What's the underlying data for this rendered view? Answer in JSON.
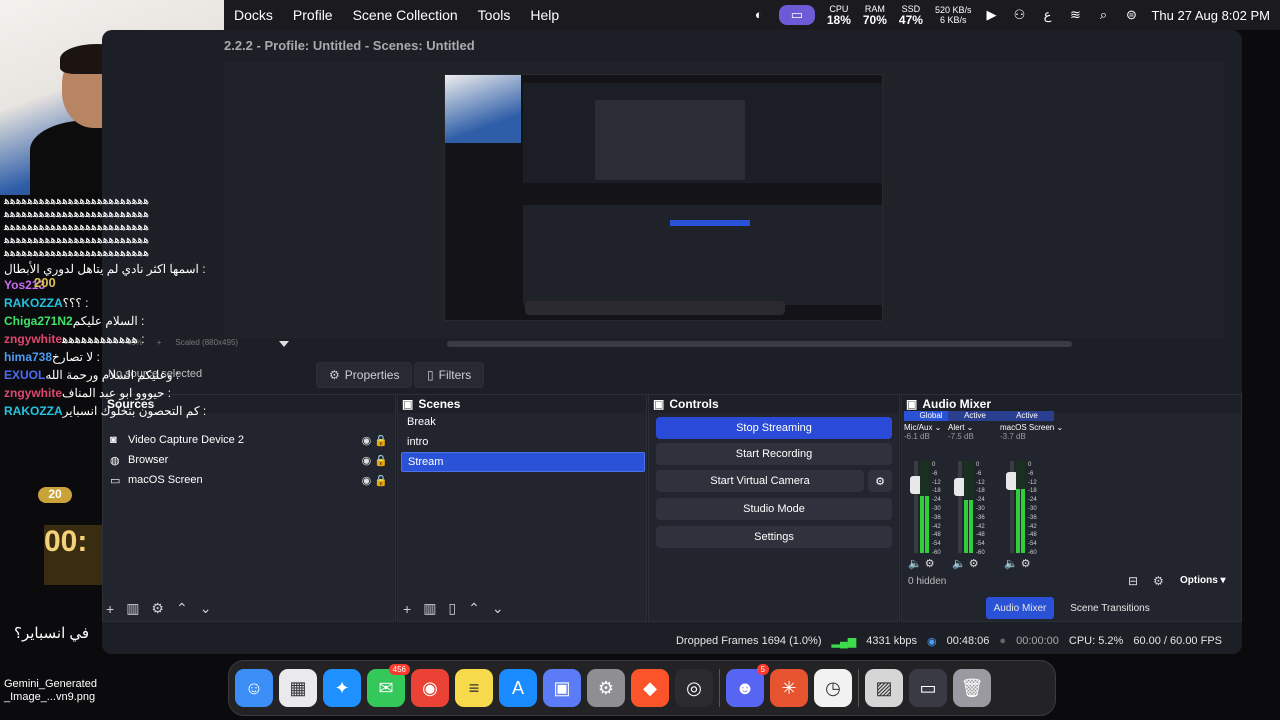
{
  "menubar": {
    "items": [
      "Docks",
      "Profile",
      "Scene Collection",
      "Tools",
      "Help"
    ],
    "cpu": {
      "label": "CPU",
      "value": "18%"
    },
    "ram": {
      "label": "RAM",
      "value": "70%"
    },
    "ssd": {
      "label": "SSD",
      "value": "47%"
    },
    "net_up": "520 KB/s",
    "net_down": "6 KB/s",
    "datetime": "Thu 27 Aug  8:02 PM"
  },
  "window_title": "2.2.2 - Profile: Untitled - Scenes: Untitled",
  "zoom": {
    "percent": "45%",
    "scaled": "Scaled (880x495)"
  },
  "properties_label": "Properties",
  "filters_label": "Filters",
  "no_source": "No source selected",
  "sources": {
    "header": "Sources",
    "items": [
      {
        "label": "Video Capture Device 2",
        "icon": "camera-icon"
      },
      {
        "label": "Browser",
        "icon": "globe-icon"
      },
      {
        "label": "macOS Screen",
        "icon": "monitor-icon"
      }
    ]
  },
  "scenes": {
    "header": "Scenes",
    "items": [
      "Break",
      "intro",
      "Stream"
    ],
    "selected": "Stream"
  },
  "controls": {
    "header": "Controls",
    "stop_streaming": "Stop Streaming",
    "start_recording": "Start Recording",
    "start_virtual_camera": "Start Virtual Camera",
    "studio_mode": "Studio Mode",
    "settings": "Settings"
  },
  "audio_mixer": {
    "header": "Audio Mixer",
    "channels": [
      {
        "tag": "Global",
        "name": "Mic/Aux",
        "db": "-6.1 dB",
        "level": 0.62,
        "slider": 0.9
      },
      {
        "tag": "Active",
        "name": "Alert",
        "db": "-7.5 dB",
        "level": 0.58,
        "slider": 0.88
      },
      {
        "tag": "Active",
        "name": "macOS Screen",
        "db": "-3.7 dB",
        "level": 0.7,
        "slider": 0.95
      }
    ],
    "scale": [
      "0",
      "-6",
      "-12",
      "-18",
      "-24",
      "-30",
      "-36",
      "-42",
      "-48",
      "-54",
      "-60"
    ],
    "hidden": "0 hidden",
    "options": "Options",
    "tab_mixer": "Audio Mixer",
    "tab_transitions": "Scene Transitions"
  },
  "status": {
    "dropped": "Dropped Frames 1694 (1.0%)",
    "kbps": "4331 kbps",
    "stream_time": "00:48:06",
    "rec_time": "00:00:00",
    "cpu": "CPU: 5.2%",
    "fps": "60.00 / 60.00 FPS"
  },
  "chat": {
    "spam": "ﻫﻫﻫﻫﻫﻫﻫﻫﻫﻫﻫﻫﻫﻫﻫﻫﻫﻫﻫﻫﻫﻫﻫﻫﻫ",
    "lines": [
      {
        "user": "Yos213",
        "color": "#c86cf2",
        "text": "اسمها اكثر نادي لم يتاهل لدوري الأبطال"
      },
      {
        "user": "RAKOZZA",
        "color": "#23c4e0",
        "text": "؟؟؟"
      },
      {
        "user": "Chiga271N2",
        "color": "#3ee36a",
        "text": "السلام عليكم"
      },
      {
        "user": "zngywhite",
        "color": "#e0466e",
        "text": "ﻫﻫﻫﻫﻫﻫﻫﻫﻫﻫﻫﻫ"
      },
      {
        "user": "hima738",
        "color": "#4a9cf5",
        "text": "لا تصارخ"
      },
      {
        "user": "EXUOL",
        "color": "#4a6cf5",
        "text": "وعليكم السلام ورحمة الله"
      },
      {
        "user": "zngywhite",
        "color": "#e0466e",
        "text": "حيووو ابو عبد المناف"
      },
      {
        "user": "RAKOZZA",
        "color": "#23c4e0",
        "text": "كم التحصون بتخلوك انسباير"
      }
    ],
    "bottom_text": "في انسباير؟"
  },
  "overlay_numbers": [
    "200",
    "20",
    "00:"
  ],
  "desktop_file": "Gemini_Generated\n_Image_...vn9.png",
  "dock_apps": [
    {
      "name": "finder-icon",
      "color": "#3a8ef6",
      "glyph": "☺"
    },
    {
      "name": "launchpad-icon",
      "color": "#e9e9ee",
      "glyph": "▦"
    },
    {
      "name": "safari-icon",
      "color": "#1e90ff",
      "glyph": "✦"
    },
    {
      "name": "messages-icon",
      "color": "#34c759",
      "glyph": "✉",
      "badge": "456"
    },
    {
      "name": "chrome-icon",
      "color": "#ea4335",
      "glyph": "◉"
    },
    {
      "name": "notes-icon",
      "color": "#f7d94c",
      "glyph": "≡"
    },
    {
      "name": "appstore-icon",
      "color": "#1a8cff",
      "glyph": "A"
    },
    {
      "name": "preview-icon",
      "color": "#5b7cf6",
      "glyph": "▣"
    },
    {
      "name": "system-settings-icon",
      "color": "#8e8e93",
      "glyph": "⚙"
    },
    {
      "name": "brave-icon",
      "color": "#fb542b",
      "glyph": "◆"
    },
    {
      "name": "obs-icon",
      "color": "#2b2b30",
      "glyph": "◎"
    },
    {
      "name": "discord-icon",
      "color": "#5865f2",
      "glyph": "☻",
      "badge": "5"
    },
    {
      "name": "claude-icon",
      "color": "#e6532f",
      "glyph": "✳"
    },
    {
      "name": "clock-icon",
      "color": "#f2f2f2",
      "glyph": "◷"
    },
    {
      "name": "gallery-icon",
      "color": "#d6d6d6",
      "glyph": "▨"
    },
    {
      "name": "screenshot-icon",
      "color": "#3a3a44",
      "glyph": "▭"
    },
    {
      "name": "trash-icon",
      "color": "#9a9aa0",
      "glyph": "🗑"
    }
  ]
}
